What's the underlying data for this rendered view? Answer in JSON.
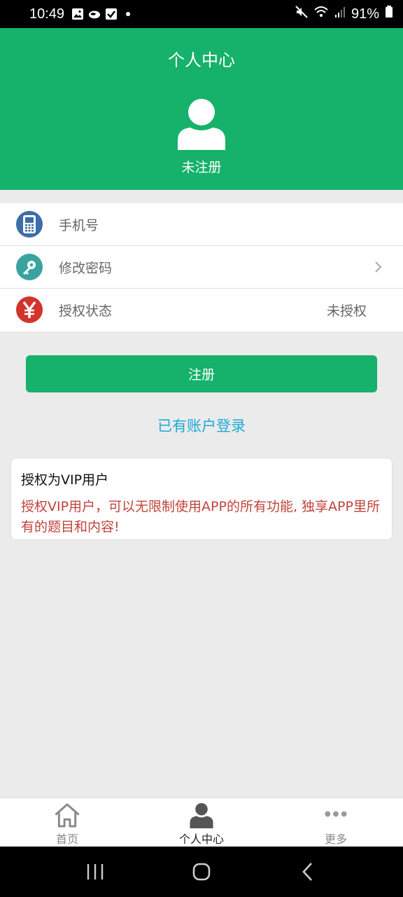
{
  "status_bar": {
    "time": "10:49",
    "battery": "91%"
  },
  "header": {
    "title": "个人中心",
    "registration_status": "未注册"
  },
  "list": {
    "items": [
      {
        "icon": "phone-icon",
        "label": "手机号",
        "value": ""
      },
      {
        "icon": "key-icon",
        "label": "修改密码",
        "value": ""
      },
      {
        "icon": "yen-icon",
        "label": "授权状态",
        "value": "未授权"
      }
    ]
  },
  "actions": {
    "register_label": "注册",
    "login_link": "已有账户登录"
  },
  "vip_card": {
    "title": "授权为VIP用户",
    "description": "授权VIP用户，可以无限制使用APP的所有功能, 独享APP里所有的题目和内容!"
  },
  "tabbar": {
    "tabs": [
      {
        "label": "首页",
        "icon": "home-icon",
        "active": false
      },
      {
        "label": "个人中心",
        "icon": "person-icon",
        "active": true
      },
      {
        "label": "更多",
        "icon": "more-icon",
        "active": false
      }
    ]
  },
  "colors": {
    "brand_green": "#16b16a",
    "link_blue": "#1eaad8",
    "warning_red": "#c0443a"
  }
}
